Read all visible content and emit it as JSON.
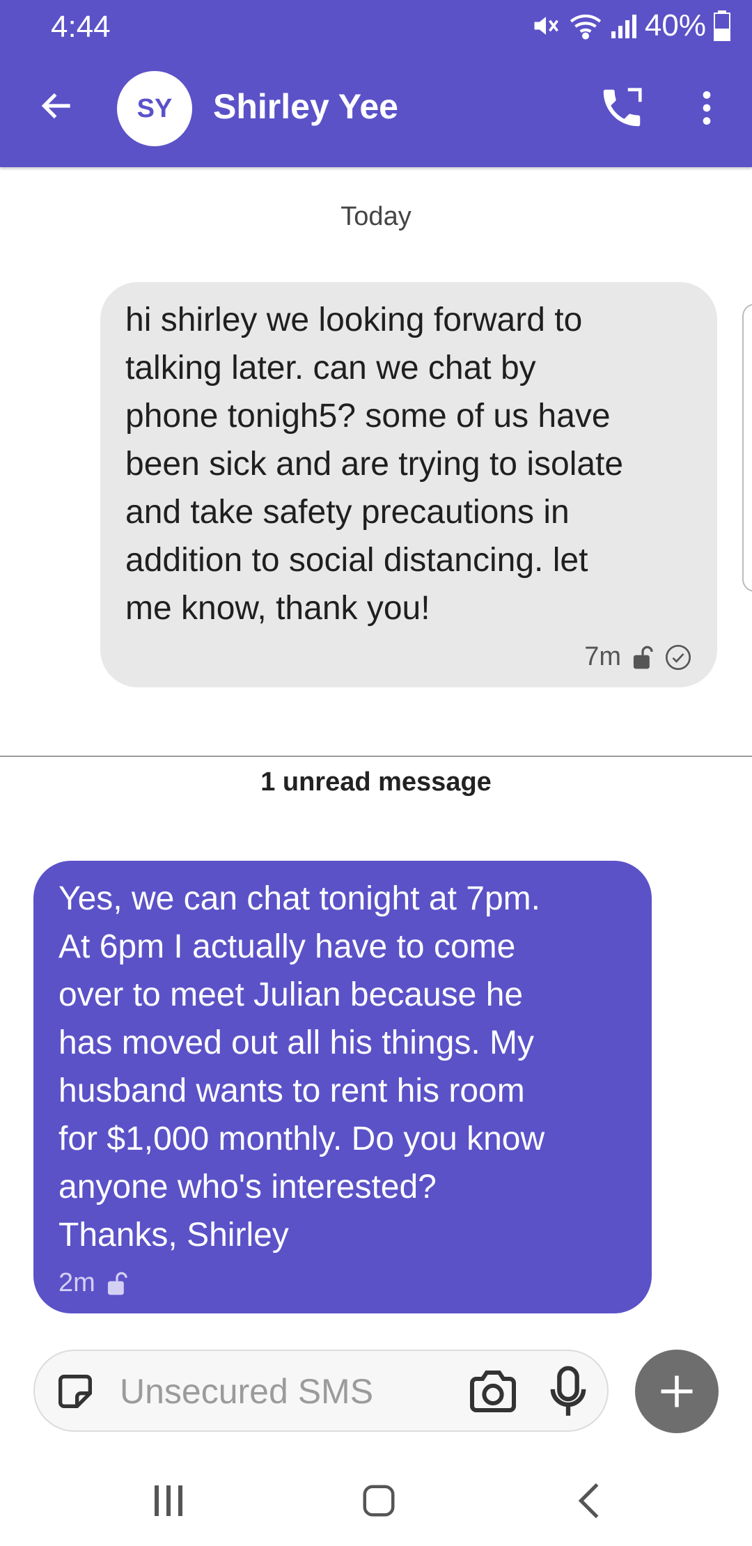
{
  "status_bar": {
    "time": "4:44",
    "battery": "40%"
  },
  "header": {
    "avatar_initials": "SY",
    "contact_name": "Shirley Yee"
  },
  "conversation": {
    "date_label": "Today",
    "unread_label": "1 unread message",
    "messages": [
      {
        "direction": "outgoing",
        "text": "hi shirley we looking forward to\ntalking later.  can we chat by\nphone tonigh5?  some of us have\nbeen sick and are trying to isolate\nand take safety precautions in\naddition to social distancing.  let\nme know, thank you!",
        "time": "7m"
      },
      {
        "direction": "incoming",
        "text": "Yes, we can chat tonight at 7pm.\nAt 6pm I actually have to come\nover to meet Julian because he\nhas moved out all his things.  My\nhusband wants to rent his room\nfor $1,000 monthly.  Do you know\nanyone who's interested?\nThanks, Shirley",
        "time": "2m"
      }
    ]
  },
  "composer": {
    "placeholder": "Unsecured SMS"
  },
  "colors": {
    "accent": "#5b52c8",
    "outgoing_bubble": "#e8e8e8",
    "plus_button": "#6e6e6e"
  },
  "icons": [
    "mute-icon",
    "wifi-icon",
    "signal-icon",
    "battery-icon",
    "back-arrow-icon",
    "call-icon",
    "more-vert-icon",
    "lock-icon",
    "check-circle-icon",
    "sticker-icon",
    "camera-icon",
    "mic-icon",
    "plus-icon",
    "recents-icon",
    "home-icon",
    "nav-back-icon"
  ]
}
